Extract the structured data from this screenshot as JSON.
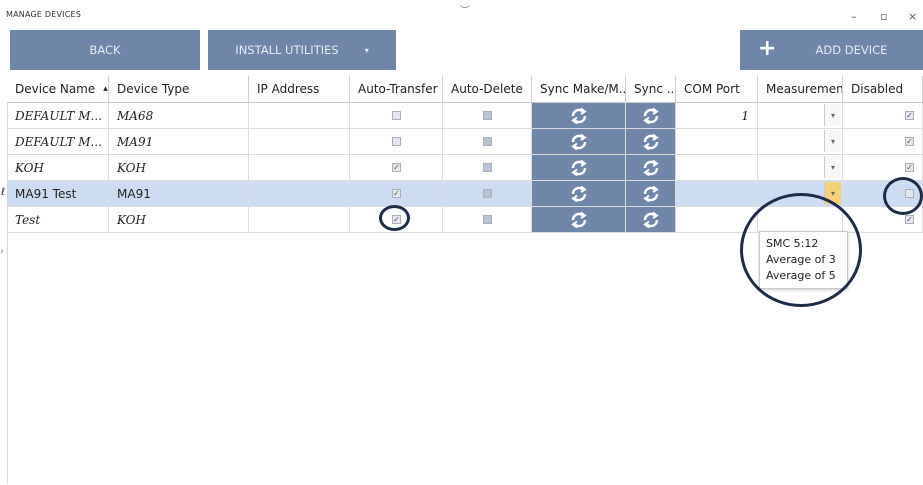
{
  "window": {
    "title": "MANAGE DEVICES",
    "minimize": "–",
    "restore": "▫",
    "close": "×"
  },
  "toolbar": {
    "back_label": "BACK",
    "install_label": "INSTALL UTILITIES",
    "install_caret": "▾",
    "add_label": "ADD DEVICE",
    "add_icon": "+"
  },
  "columns": [
    "Device Name",
    "Device Type",
    "IP Address",
    "Auto-Transfer",
    "Auto-Delete",
    "Sync Make/M...",
    "Sync ...",
    "COM Port",
    "Measuremen...",
    "Disabled"
  ],
  "sort_indicator": "▴",
  "rows": [
    {
      "name": "DEFAULT M...",
      "type": "MA68",
      "ip": "",
      "auto_transfer": false,
      "auto_delete": true,
      "com": "1",
      "dropdown": true,
      "disabled": true,
      "italic": true,
      "marker": ""
    },
    {
      "name": "DEFAULT M...",
      "type": "MA91",
      "ip": "",
      "auto_transfer": false,
      "auto_delete": true,
      "com": "",
      "dropdown": true,
      "disabled": true,
      "italic": true,
      "marker": ""
    },
    {
      "name": "KOH",
      "type": "KOH",
      "ip": "",
      "auto_transfer": true,
      "auto_delete": true,
      "com": "",
      "dropdown": true,
      "disabled": true,
      "italic": true,
      "marker": ""
    },
    {
      "name": "MA91 Test",
      "type": "MA91",
      "ip": "",
      "auto_transfer": true,
      "auto_delete": true,
      "com": "",
      "dropdown": true,
      "disabled": false,
      "italic": false,
      "marker": "ℓ"
    },
    {
      "name": "Test",
      "type": "KOH",
      "ip": "",
      "auto_transfer": true,
      "auto_delete": true,
      "com": "",
      "dropdown": false,
      "disabled": true,
      "italic": true,
      "marker": ""
    }
  ],
  "measurement_options": [
    "SMC 5:12",
    "Average of 3",
    "Average of 5"
  ],
  "icons": {
    "sync": "sync-arrows-icon",
    "dropdown": "chevron-down-icon"
  },
  "colors": {
    "accent": "#6f86a8",
    "selected_row": "#cddcf0",
    "annotation": "#1e2d47"
  }
}
